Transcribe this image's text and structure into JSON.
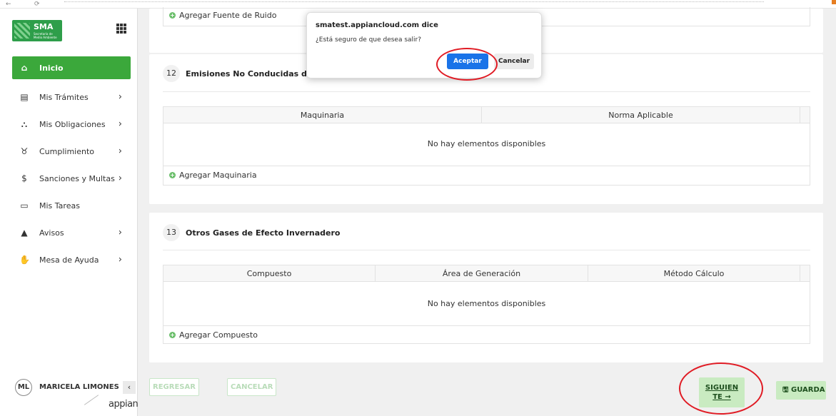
{
  "browser": {
    "back_glyph": "←",
    "reload_glyph": "⟳"
  },
  "sidebar": {
    "logo": {
      "short": "SMA",
      "full": "Secretaría de Medio Ambiente"
    },
    "nav": [
      {
        "label": "Inicio",
        "icon": "home-icon",
        "glyph": "⌂",
        "active": true,
        "chevron": false
      },
      {
        "label": "Mis Trámites",
        "icon": "document-icon",
        "glyph": "▤",
        "active": false,
        "chevron": true
      },
      {
        "label": "Mis Obligaciones",
        "icon": "bank-icon",
        "glyph": "⛬",
        "active": false,
        "chevron": true
      },
      {
        "label": "Cumplimiento",
        "icon": "trophy-icon",
        "glyph": "♉",
        "active": false,
        "chevron": true
      },
      {
        "label": "Sanciones y Multas",
        "icon": "money-bag-icon",
        "glyph": "$",
        "active": false,
        "chevron": true
      },
      {
        "label": "Mis Tareas",
        "icon": "briefcase-icon",
        "glyph": "▭",
        "active": false,
        "chevron": false
      },
      {
        "label": "Avisos",
        "icon": "warning-icon",
        "glyph": "▲",
        "active": false,
        "chevron": true
      },
      {
        "label": "Mesa de Ayuda",
        "icon": "handshake-icon",
        "glyph": "✋",
        "active": false,
        "chevron": true
      }
    ],
    "chevron_glyph": "›",
    "user": {
      "initials": "ML",
      "name": "MARICELA LIMONES"
    },
    "collapse_glyph": "‹",
    "brand": "appian"
  },
  "main": {
    "section11": {
      "add_label": "Agregar Fuente de Ruido"
    },
    "section12": {
      "number": "12",
      "title": "Emisiones No Conducidas de Maquinaria",
      "columns": [
        "Maquinaria",
        "Norma Aplicable"
      ],
      "empty_text": "No hay elementos disponibles",
      "add_label": "Agregar Maquinaria"
    },
    "section13": {
      "number": "13",
      "title": "Otros Gases de Efecto Invernadero",
      "columns": [
        "Compuesto",
        "Área de Generación",
        "Método Cálculo"
      ],
      "empty_text": "No hay elementos disponibles",
      "add_label": "Agregar Compuesto"
    },
    "plus_glyph": "+"
  },
  "footer": {
    "back_label": "REGRESAR",
    "cancel_label": "CANCELAR",
    "next_label_1": "SIGUIEN",
    "next_label_2": "TE →",
    "save_label": "🖫 GUARDA"
  },
  "dialog": {
    "title": "smatest.appiancloud.com dice",
    "message": "¿Está seguro de que desea salir?",
    "ok_label": "Aceptar",
    "cancel_label": "Cancelar"
  },
  "colors": {
    "accent_green": "#3ba83b",
    "dialog_blue": "#1a73e8",
    "annotation_red": "#e01b24",
    "next_button_bg": "#c9ebc1"
  }
}
